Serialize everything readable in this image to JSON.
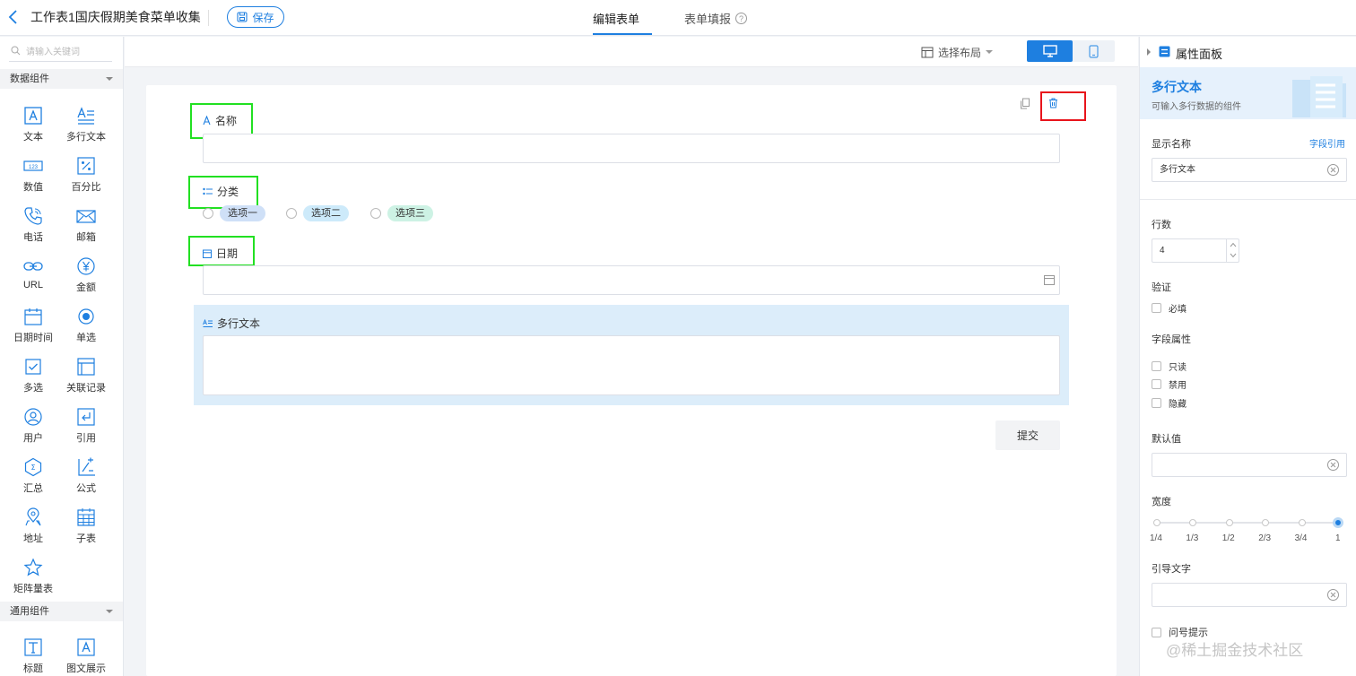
{
  "header": {
    "title": "工作表1国庆假期美食菜单收集",
    "save_label": "保存",
    "tabs": [
      {
        "label": "编辑表单",
        "active": true
      },
      {
        "label": "表单填报",
        "active": false
      }
    ]
  },
  "left_panel": {
    "search_placeholder": "请输入关键词",
    "groups": [
      {
        "title": "数据组件",
        "items": [
          {
            "label": "文本",
            "icon": "text-icon"
          },
          {
            "label": "多行文本",
            "icon": "multiline-text-icon"
          },
          {
            "label": "数值",
            "icon": "number-icon"
          },
          {
            "label": "百分比",
            "icon": "percent-icon"
          },
          {
            "label": "电话",
            "icon": "phone-icon"
          },
          {
            "label": "邮箱",
            "icon": "mail-icon"
          },
          {
            "label": "URL",
            "icon": "link-icon"
          },
          {
            "label": "金额",
            "icon": "currency-icon"
          },
          {
            "label": "日期时间",
            "icon": "calendar-icon"
          },
          {
            "label": "单选",
            "icon": "radio-icon"
          },
          {
            "label": "多选",
            "icon": "checkbox-icon"
          },
          {
            "label": "关联记录",
            "icon": "relation-icon"
          },
          {
            "label": "用户",
            "icon": "user-icon"
          },
          {
            "label": "引用",
            "icon": "reference-icon"
          },
          {
            "label": "汇总",
            "icon": "summary-icon"
          },
          {
            "label": "公式",
            "icon": "formula-icon"
          },
          {
            "label": "地址",
            "icon": "location-icon"
          },
          {
            "label": "子表",
            "icon": "subtable-icon"
          },
          {
            "label": "矩阵量表",
            "icon": "star-icon"
          }
        ]
      },
      {
        "title": "通用组件",
        "items": [
          {
            "label": "标题",
            "icon": "title-icon"
          },
          {
            "label": "图文展示",
            "icon": "image-text-icon"
          }
        ]
      }
    ]
  },
  "center": {
    "layout_label": "选择布局",
    "form": {
      "fields": [
        {
          "label": "名称",
          "icon": "text-icon",
          "type": "text"
        },
        {
          "label": "分类",
          "icon": "list-icon",
          "type": "radio",
          "options": [
            "选项一",
            "选项二",
            "选项三"
          ],
          "option_colors": [
            "#cfe0f7",
            "#cdeafa",
            "#cdf2e4"
          ]
        },
        {
          "label": "日期",
          "icon": "calendar-icon",
          "type": "date"
        },
        {
          "label": "多行文本",
          "icon": "multiline-text-icon",
          "type": "textarea",
          "selected": true
        }
      ],
      "submit_label": "提交"
    }
  },
  "right_panel": {
    "title": "属性面板",
    "component_name": "多行文本",
    "component_desc": "可输入多行数据的组件",
    "display_name_label": "显示名称",
    "field_ref_link": "字段引用",
    "display_name_value": "多行文本",
    "rows_label": "行数",
    "rows_value": "4",
    "validation_label": "验证",
    "required_label": "必填",
    "field_attr_label": "字段属性",
    "attrs": [
      "只读",
      "禁用",
      "隐藏"
    ],
    "default_label": "默认值",
    "default_value": "",
    "width_label": "宽度",
    "width_ticks": [
      "1/4",
      "1/3",
      "1/2",
      "2/3",
      "3/4",
      "1"
    ],
    "width_selected": "1",
    "placeholder_label": "引导文字",
    "placeholder_value": "",
    "tooltip_label": "问号提示"
  },
  "colors": {
    "accent": "#1e7fe0",
    "highlight_green": "#22e022",
    "highlight_red": "#e8141c",
    "selected_bg": "#dcedfa"
  },
  "watermark": "@稀土掘金技术社区"
}
